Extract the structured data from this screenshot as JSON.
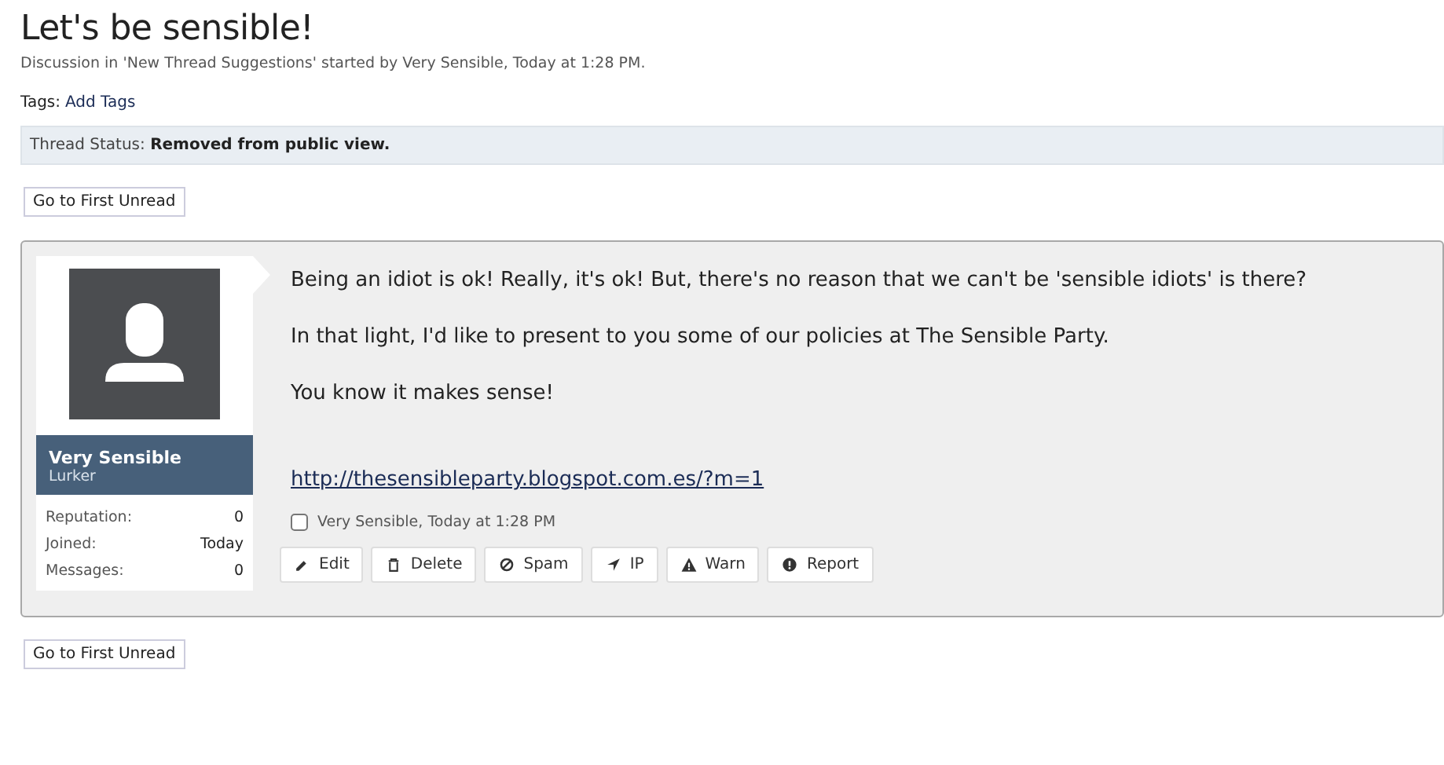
{
  "thread": {
    "title": "Let's be sensible!",
    "meta": "Discussion in 'New Thread Suggestions' started by Very Sensible, Today at 1:28 PM.",
    "tags_label": "Tags:",
    "tags_link": "Add Tags",
    "status": "Thread Status: **Removed from public view.**"
  },
  "first_unread_top": "Go to First Unread",
  "post": {
    "author": {
      "name": "Very Sensible",
      "title": "Lurker",
      "stats": [
        {
          "label": "Reputation:",
          "value": "0"
        },
        {
          "label": "Joined:",
          "value": "Today"
        },
        {
          "label": "Messages:",
          "value": "0"
        }
      ]
    },
    "paragraphs": [
      "Being an idiot is ok! Really, it's ok! But, there's no reason that we can't be 'sensible idiots' is there?",
      "In that light, I'd like to present to you some of our policies at The Sensible Party.",
      "You know it makes sense!"
    ],
    "link": "http://thesensibleparty.blogspot.com.es/?m=1",
    "select": {
      "label": "Very Sensible, Today at 1:28 PM",
      "checked": false
    },
    "actions": [
      {
        "kind": "edit",
        "label": "Edit"
      },
      {
        "kind": "delete",
        "label": "Delete"
      },
      {
        "kind": "spam",
        "label": "Spam"
      },
      {
        "kind": "ip",
        "label": "IP"
      },
      {
        "kind": "warn",
        "label": "Warn"
      },
      {
        "kind": "report",
        "label": "Report"
      }
    ]
  },
  "first_unread_bottom": "Go to First Unread"
}
